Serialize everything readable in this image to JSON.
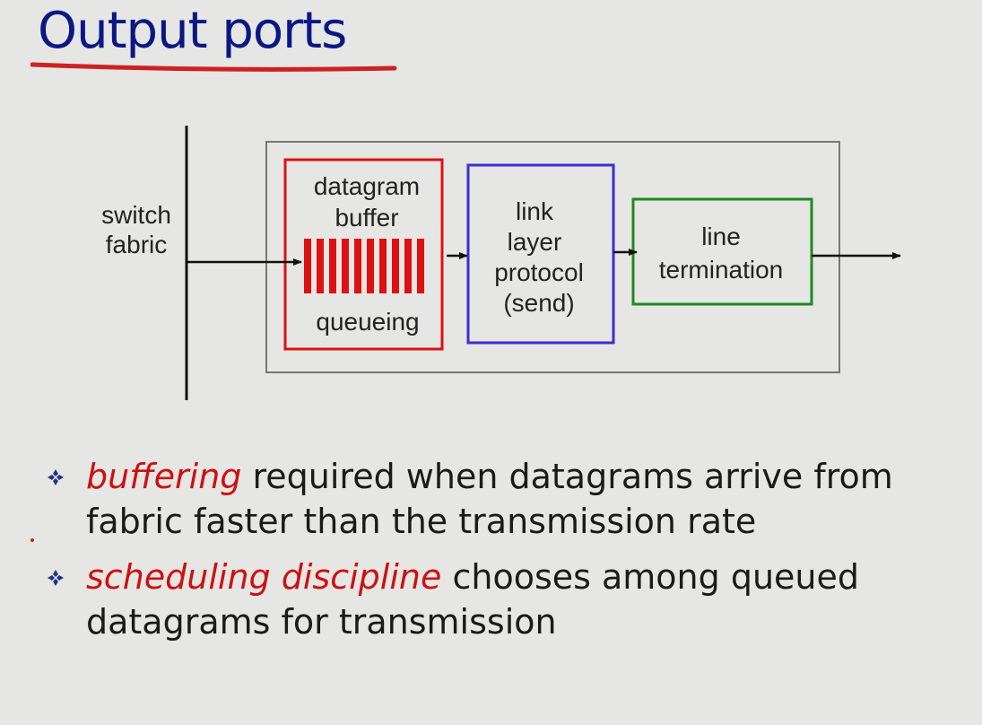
{
  "title": "Output ports",
  "diagram": {
    "switch_label_1": "switch",
    "switch_label_2": "fabric",
    "buffer_label_1": "datagram",
    "buffer_label_2": "buffer",
    "queue_label": "queueing",
    "link_label_1": "link",
    "link_label_2": "layer",
    "link_label_3": "protocol",
    "link_label_4": "(send)",
    "line_label_1": "line",
    "line_label_2": "termination"
  },
  "bullets": [
    {
      "emphasis": "buffering",
      "text": " required when datagrams arrive from fabric faster than the transmission rate"
    },
    {
      "emphasis": "scheduling discipline",
      "text": " chooses among queued datagrams for transmission"
    }
  ],
  "colors": {
    "title": "#0b1784",
    "underline": "#cc2222",
    "emphasis": "#cc1111",
    "buffer_box": "#dd1111",
    "link_box": "#3a2fd0",
    "line_box": "#1f8a1f",
    "outer_box": "#777777"
  }
}
